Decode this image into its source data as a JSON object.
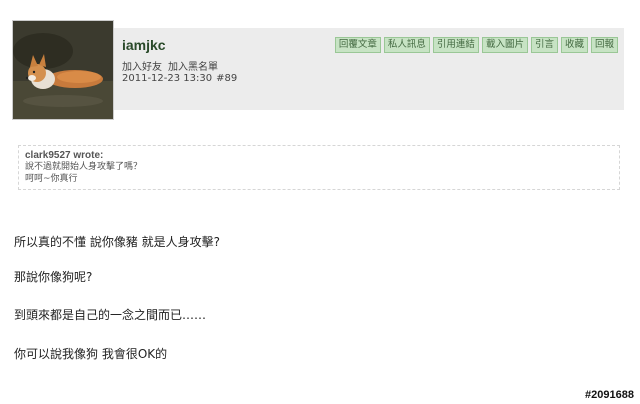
{
  "user": {
    "name": "iamjkc",
    "add_friend": "加入好友",
    "add_blacklist": "加入黑名單"
  },
  "post": {
    "datetime": "2011-12-23 13:30",
    "floor": "#89"
  },
  "actions": [
    "回覆文章",
    "私人訊息",
    "引用連結",
    "載入圖片",
    "引言",
    "收藏",
    "回報"
  ],
  "quote": {
    "author": "clark9527 wrote:",
    "lines": [
      "說不過就開始人身攻擊了嗎？",
      "呵呵~你真行"
    ]
  },
  "body": {
    "lines": [
      "所以真的不懂 說你像豬 就是人身攻擊?",
      "那說你像狗呢?",
      "到頭來都是自己的一念之間而已……",
      "你可以說我像狗 我會很OK的"
    ]
  },
  "watermark": "#2091688",
  "colors": {
    "action_bg": "#c7e3c4",
    "action_border": "#9ac796",
    "info_bar_bg": "#ececec"
  }
}
